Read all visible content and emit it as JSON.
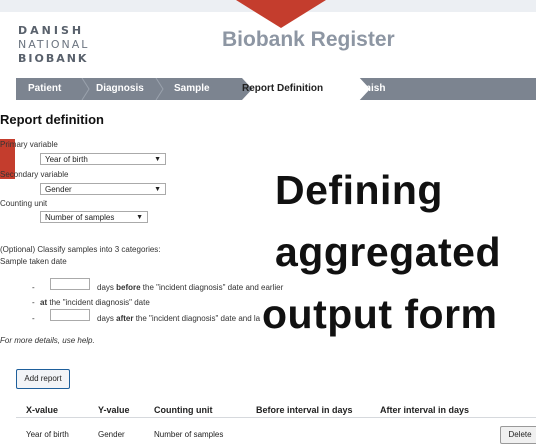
{
  "logo": {
    "line1": "DANISH",
    "line2": "NATIONAL",
    "line3": "BIOBANK"
  },
  "app_title": "Biobank Register",
  "nav_steps": [
    "Patient",
    "Diagnosis",
    "Sample",
    "Report Definition",
    "Finish"
  ],
  "section_title": "Report definition",
  "primary": {
    "label": "Primary variable",
    "value": "Year of birth"
  },
  "secondary": {
    "label": "Secondary variable",
    "value": "Gender"
  },
  "counting": {
    "label": "Counting unit",
    "value": "Number of samples"
  },
  "optional": {
    "line1": "(Optional) Classify samples into 3 categories:",
    "line2": "Sample taken date"
  },
  "cat1": {
    "dash": "-",
    "pre": "days ",
    "bold": "before",
    "post": " the \"incident diagnosis\" date and earlier"
  },
  "cat2": {
    "dash": "-",
    "bold": "at",
    "post": " the \"incident diagnosis\" date"
  },
  "cat3": {
    "dash": "-",
    "pre": "days ",
    "bold": "after",
    "post": " the \"incident diagnosis\" date and la"
  },
  "overlay": {
    "line1": "Defining",
    "line2": "aggregated",
    "line3": "output form"
  },
  "help_text": "For more details, use help.",
  "add_report_label": "Add report",
  "table": {
    "headers": [
      "X-value",
      "Y-value",
      "Counting unit",
      "Before interval in days",
      "After interval in days"
    ],
    "row": [
      "Year of birth",
      "Gender",
      "Number of samples"
    ],
    "delete_label": "Delete"
  },
  "colors": {
    "accent_red": "#c43d2d",
    "nav_gray": "#7c8490"
  }
}
